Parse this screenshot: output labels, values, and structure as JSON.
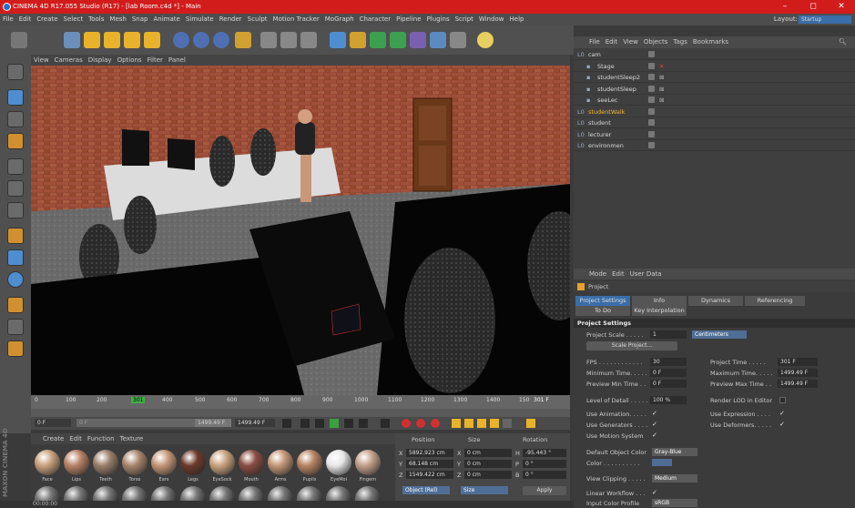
{
  "window": {
    "title": "CINEMA 4D R17.055 Studio (R17) - [lab Room.c4d *] - Main",
    "minimize": "–",
    "restore": "◻",
    "close": "✕"
  },
  "menu": [
    "File",
    "Edit",
    "Create",
    "Select",
    "Tools",
    "Mesh",
    "Snap",
    "Animate",
    "Simulate",
    "Render",
    "Sculpt",
    "Motion Tracker",
    "MoGraph",
    "Character",
    "Pipeline",
    "Plugins",
    "Script",
    "Window",
    "Help"
  ],
  "layout": {
    "label": "Layout:",
    "value": "Startup"
  },
  "viewport_menu": [
    "View",
    "Cameras",
    "Display",
    "Options",
    "Filter",
    "Panel"
  ],
  "timeline": {
    "ticks": [
      "0",
      "100",
      "200",
      "301",
      "400",
      "500",
      "600",
      "700",
      "800",
      "900",
      "1000",
      "1100",
      "1200",
      "1300",
      "1400",
      "150"
    ],
    "current": "301 F"
  },
  "playback": {
    "start": "0 F",
    "field": "0 F",
    "end_a": "1499.49 F",
    "end_b": "1499.49 F"
  },
  "material_menu": [
    "Create",
    "Edit",
    "Function",
    "Texture"
  ],
  "materials": [
    {
      "name": "Face",
      "color": "#c9a27e"
    },
    {
      "name": "Lips",
      "color": "#b98266"
    },
    {
      "name": "Teeth",
      "color": "#9a7f6b"
    },
    {
      "name": "Torso",
      "color": "#a8866c"
    },
    {
      "name": "Ears",
      "color": "#c49777"
    },
    {
      "name": "Legs",
      "color": "#6b3a2a"
    },
    {
      "name": "EyeSock",
      "color": "#c9a27e"
    },
    {
      "name": "Mouth",
      "color": "#8a4d42"
    },
    {
      "name": "Arms",
      "color": "#c49777"
    },
    {
      "name": "Pupils",
      "color": "#b78462"
    },
    {
      "name": "EyeMoi",
      "color": "#e8e8e8"
    },
    {
      "name": "Fingern",
      "color": "#c3a08a"
    }
  ],
  "maxon_brand": "MAXON CINEMA 4D",
  "coords": {
    "headers": [
      "Position",
      "Size",
      "Rotation"
    ],
    "rows": [
      {
        "axis": "X",
        "pos": "5892.923 cm",
        "saxis": "X",
        "size": "0 cm",
        "raxis": "H",
        "rot": "-95.443 °"
      },
      {
        "axis": "Y",
        "pos": "68.148 cm",
        "saxis": "Y",
        "size": "0 cm",
        "raxis": "P",
        "rot": "0 °"
      },
      {
        "axis": "Z",
        "pos": "1549.422 cm",
        "saxis": "Z",
        "size": "0 cm",
        "raxis": "B",
        "rot": "0 °"
      }
    ],
    "mode": "Object (Rel)",
    "size_mode": "Size",
    "apply": "Apply"
  },
  "status": "00:00:00",
  "object_manager": {
    "menu": [
      "File",
      "Edit",
      "View",
      "Objects",
      "Tags",
      "Bookmarks"
    ],
    "items": [
      {
        "name": "cam",
        "indent": 0,
        "color": "#d8d8d8",
        "x": "",
        "xcolor": "#999"
      },
      {
        "name": "Stage",
        "indent": 1,
        "color": "#d8d8d8",
        "x": "✕",
        "xcolor": "#e04040"
      },
      {
        "name": "studentSleep2",
        "indent": 1,
        "color": "#d8d8d8",
        "x": "⊠",
        "xcolor": "#aaa"
      },
      {
        "name": "studentSleep",
        "indent": 1,
        "color": "#d8d8d8",
        "x": "⊠",
        "xcolor": "#aaa"
      },
      {
        "name": "seeLec",
        "indent": 1,
        "color": "#d8d8d8",
        "x": "⊠",
        "xcolor": "#aaa"
      },
      {
        "name": "studentWalk",
        "indent": 0,
        "color": "#f0b838",
        "x": "",
        "xcolor": "#6c6"
      },
      {
        "name": "student",
        "indent": 0,
        "color": "#d8d8d8",
        "x": "",
        "xcolor": "#999"
      },
      {
        "name": "lecturer",
        "indent": 0,
        "color": "#d8d8d8",
        "x": "",
        "xcolor": "#999"
      },
      {
        "name": "environmen",
        "indent": 0,
        "color": "#d8d8d8",
        "x": "",
        "xcolor": "#999"
      }
    ]
  },
  "attributes": {
    "menu": [
      "Mode",
      "Edit",
      "User Data"
    ],
    "object": "Project",
    "tabs": [
      "Project Settings",
      "Info",
      "Dynamics",
      "Referencing",
      "To Do",
      "Key Interpolation"
    ],
    "section": "Project Settings",
    "project_scale_label": "Project Scale . . . . .",
    "project_scale": "1",
    "unit": "Centimeters",
    "scale_button": "Scale Project...",
    "fps_label": "FPS . . . . . . . . . . . .",
    "fps": "30",
    "project_time_label": "Project Time . . . . .",
    "project_time": "301 F",
    "min_time_label": "Minimum Time. . . . .",
    "min_time": "0 F",
    "max_time_label": "Maximum Time. . . . .",
    "max_time": "1499.49 F",
    "prev_min_label": "Preview Min Time . .",
    "prev_min": "0 F",
    "prev_max_label": "Preview Max Time . .",
    "prev_max": "1499.49 F",
    "lod_label": "Level of Detail . . . . .",
    "lod": "100 %",
    "render_lod_label": "Render LOD in Editor",
    "use_anim_label": "Use Animation. . . . .",
    "use_expr_label": "Use Expression . . . .",
    "use_gen_label": "Use Generators . . . .",
    "use_def_label": "Use Deformers. . . . .",
    "use_motion_label": "Use Motion System",
    "def_color_label": "Default Object Color",
    "def_color": "Gray-Blue",
    "color_label": "Color . . . . . . . . . .",
    "view_clip_label": "View Clipping . . . . .",
    "view_clip": "Medium",
    "linear_label": "Linear Workflow . . .",
    "input_profile_label": "Input Color Profile",
    "input_profile": "sRGB",
    "check": "✓"
  }
}
